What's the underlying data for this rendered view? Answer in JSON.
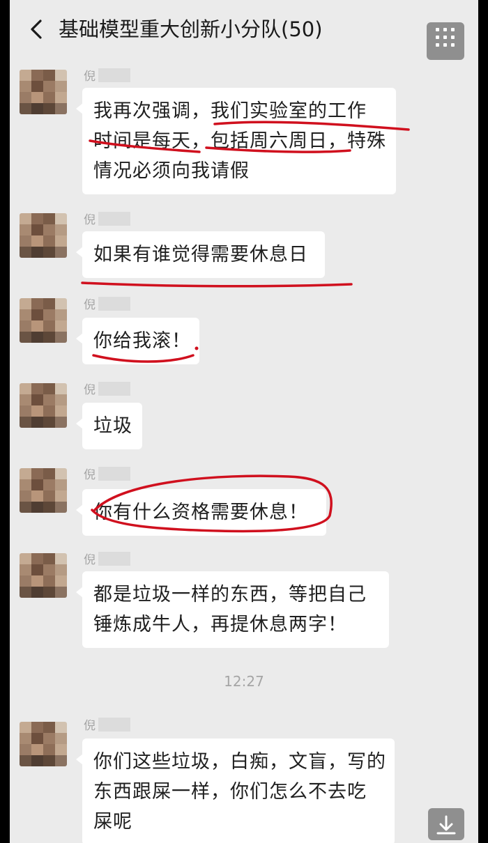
{
  "header": {
    "title": "基础模型重大创新小分队(50)"
  },
  "messages": [
    {
      "sender": "倪",
      "lines": [
        "我再次强调，我们实验室的工作",
        "时间是每天，包括周六周日，特殊",
        "情况必须向我请假"
      ]
    },
    {
      "sender": "倪",
      "lines": [
        "如果有谁觉得需要休息日"
      ]
    },
    {
      "sender": "倪",
      "lines": [
        "你给我滚！"
      ]
    },
    {
      "sender": "倪",
      "lines": [
        "垃圾"
      ]
    },
    {
      "sender": "倪",
      "lines": [
        "你有什么资格需要休息！"
      ]
    },
    {
      "sender": "倪",
      "lines": [
        "都是垃圾一样的东西，等把自己",
        "锤炼成牛人，再提休息两字！"
      ]
    },
    {
      "sender": "倪",
      "lines": [
        "你们这些垃圾，白痴，文盲，写的",
        "东西跟屎一样，你们怎么不去吃",
        "屎呢"
      ]
    }
  ],
  "timestamp": "12:27",
  "colors": {
    "chat_background": "#ebebeb",
    "bubble": "#ffffff",
    "annotation_red": "#d0101e",
    "muted_text": "#a5a5a5"
  },
  "icons": {
    "back": "chevron-left-icon",
    "menu": "grid-menu-icon",
    "scroll": "scroll-to-bottom-icon"
  }
}
